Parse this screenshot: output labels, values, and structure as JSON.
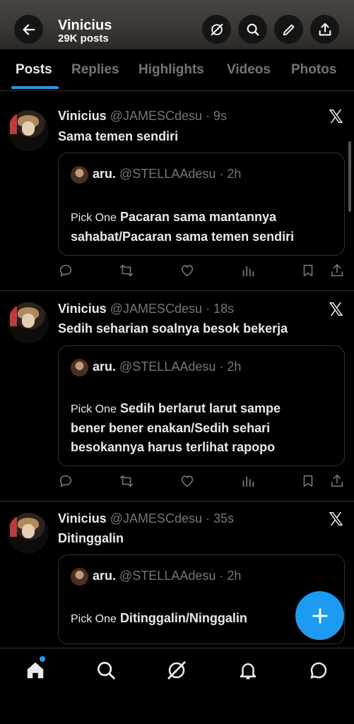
{
  "header": {
    "title": "Vinicius",
    "subtitle": "29K posts"
  },
  "tabs": [
    {
      "label": "Posts",
      "active": true
    },
    {
      "label": "Replies"
    },
    {
      "label": "Highlights"
    },
    {
      "label": "Videos"
    },
    {
      "label": "Photos"
    }
  ],
  "posts": [
    {
      "name": "Vinicius",
      "handle": "@JAMESCdesu",
      "time": "· 9s",
      "text": "Sama temen sendiri",
      "quote": {
        "name": "aru.",
        "handle": "@STELLAAdesu",
        "time": "· 2h",
        "label": "Pick One",
        "lines": [
          "Pacaran sama mantannya",
          "sahabat/Pacaran sama temen sendiri"
        ]
      }
    },
    {
      "name": "Vinicius",
      "handle": "@JAMESCdesu",
      "time": "· 18s",
      "text": "Sedih seharian soalnya besok bekerja",
      "quote": {
        "name": "aru.",
        "handle": "@STELLAAdesu",
        "time": "· 2h",
        "label": "Pick One",
        "lines": [
          "Sedih berlarut larut sampe",
          "bener bener enakan/Sedih sehari",
          "besokannya harus terlihat rapopo"
        ]
      }
    },
    {
      "name": "Vinicius",
      "handle": "@JAMESCdesu",
      "time": "· 35s",
      "text": "Ditinggalin",
      "quote": {
        "name": "aru.",
        "handle": "@STELLAAdesu",
        "time": "· 2h",
        "label": "Pick One",
        "lines": [
          "Ditinggalin/Ninggalin"
        ]
      }
    }
  ],
  "colors": {
    "accent": "#1d9bf0",
    "background": "#000000",
    "muted": "#71767b"
  }
}
